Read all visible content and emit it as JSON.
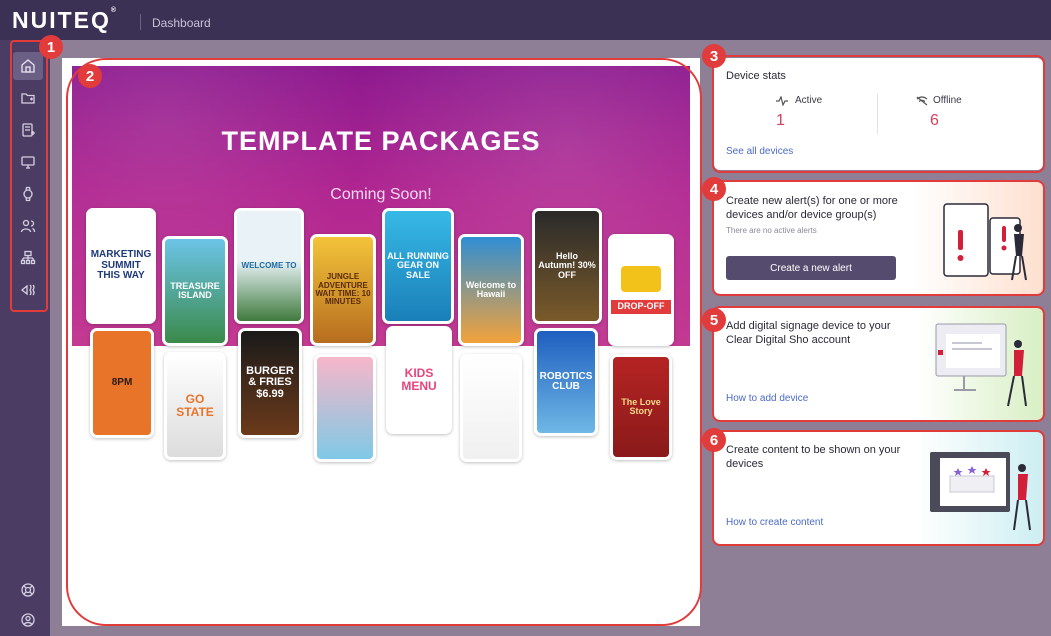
{
  "app": {
    "logo": "NUITEQ",
    "logo_mark": "®",
    "page": "Dashboard"
  },
  "sidebar": {
    "items": [
      {
        "name": "home-icon",
        "active": true
      },
      {
        "name": "folder-icon"
      },
      {
        "name": "content-icon"
      },
      {
        "name": "device-icon"
      },
      {
        "name": "watch-icon"
      },
      {
        "name": "users-icon"
      },
      {
        "name": "groups-icon"
      },
      {
        "name": "broadcast-icon"
      }
    ],
    "bottom": [
      {
        "name": "help-icon"
      },
      {
        "name": "account-icon"
      }
    ]
  },
  "callouts": [
    "1",
    "2",
    "3",
    "4",
    "5",
    "6"
  ],
  "banner": {
    "title": "TEMPLATE PACKAGES",
    "subtitle": "Coming Soon!",
    "thumbnails": [
      {
        "text": "MARKETING SUMMIT THIS WAY"
      },
      {
        "text": "TREASURE ISLAND"
      },
      {
        "text": "WELCOME TO"
      },
      {
        "text": "JUNGLE ADVENTURE WAIT TIME: 10 MINUTES"
      },
      {
        "text": "ALL RUNNING GEAR ON SALE"
      },
      {
        "text": "Welcome to Hawaii"
      },
      {
        "text": "Hello Autumn! 30% OFF"
      },
      {
        "text": "DROP-OFF"
      },
      {
        "text": "8PM"
      },
      {
        "text": "GO STATE"
      },
      {
        "text": "BURGER & FRIES $6.99"
      },
      {
        "text": ""
      },
      {
        "text": "KIDS MENU"
      },
      {
        "text": ""
      },
      {
        "text": "ROBOTICS CLUB"
      },
      {
        "text": "The Love Story"
      }
    ]
  },
  "device_stats": {
    "title": "Device stats",
    "active_label": "Active",
    "active_value": "1",
    "offline_label": "Offline",
    "offline_value": "6",
    "link": "See all devices"
  },
  "alerts": {
    "title_line1": "Create new alert(s) for one or more",
    "title_line2": "devices and/or device group(s)",
    "sub": "There are no active alerts",
    "button": "Create a new alert"
  },
  "add_device": {
    "title_line1": "Add digital signage device to your",
    "title_line2": "Clear Digital Sho account",
    "link": "How to add device"
  },
  "create_content": {
    "title_line1": "Create content to be shown on your",
    "title_line2": "devices",
    "link": "How to create content"
  },
  "colors": {
    "accent": "#e23b3b",
    "sidebar": "#4a3c63",
    "topbar": "#3b3155",
    "stat": "#d4405b",
    "link": "#4b6ac8"
  }
}
